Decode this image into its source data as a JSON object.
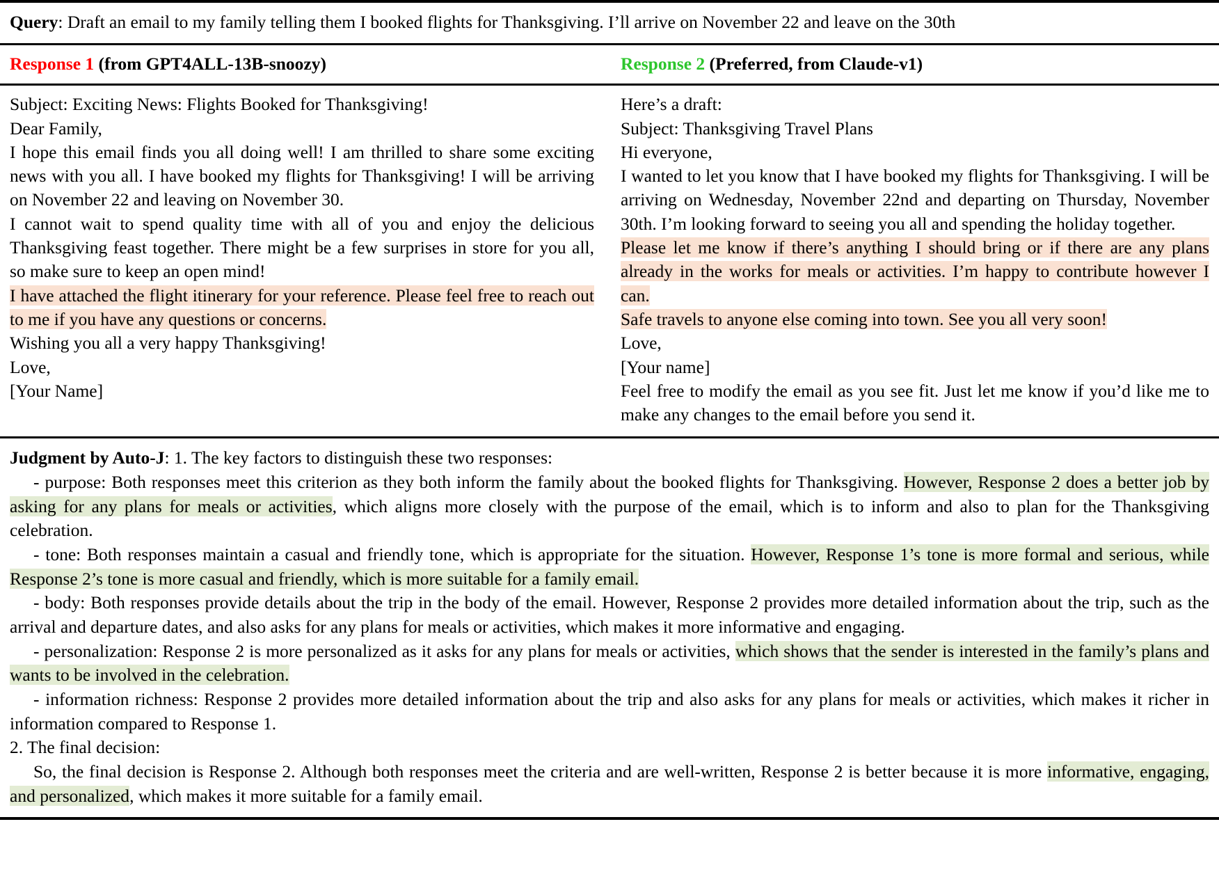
{
  "colors": {
    "response1_accent": "#ff0000",
    "response2_accent": "#2dc62d",
    "highlight_orange": "#fae1d2",
    "highlight_green": "#e3ecd4",
    "rule": "#000000",
    "background": "#ffffff"
  },
  "query": {
    "label": "Query",
    "separator": ": ",
    "text": "Draft an email to my family telling them I booked flights for Thanksgiving. I’ll arrive on November 22 and leave on the 30th"
  },
  "responses": [
    {
      "id": "response-1",
      "heading_number": "Response 1",
      "heading_meta": " (from GPT4ALL-13B-snoozy)",
      "accent": "#ff0000",
      "lines": [
        {
          "plain": "Subject: Exciting News: Flights Booked for Thanksgiving!"
        },
        {
          "plain": "Dear Family,"
        },
        {
          "plain": "I hope this email finds you all doing well!  I am thrilled to share some exciting news with you all.  I have booked my flights for Thanksgiving! I will be arriving on November 22 and leaving on November 30."
        },
        {
          "plain": "I cannot wait to spend quality time with all of you and enjoy the de­licious Thanksgiving feast together. There might be a few surprises in store for you all, so make sure to keep an open mind!"
        },
        {
          "highlight": "I have attached the flight itinerary for your reference. Please feel free to reach out to me if you have any questions or concerns."
        },
        {
          "plain": "Wishing you all a very happy Thanksgiving!"
        },
        {
          "plain": "Love,"
        },
        {
          "plain": "[Your Name]"
        }
      ]
    },
    {
      "id": "response-2",
      "heading_number": "Response 2",
      "heading_meta": " (Preferred, from Claude-v1)",
      "accent": "#2dc62d",
      "lines": [
        {
          "plain": "Here’s a draft:"
        },
        {
          "plain": "Subject: Thanksgiving Travel Plans"
        },
        {
          "plain": "Hi everyone,"
        },
        {
          "plain": "I wanted to let you know that I have booked my flights for Thanks­giving.  I will be arriving on Wednesday, November 22nd and departing on Thursday, November 30th.  I’m looking forward to seeing you all and spending the holiday together."
        },
        {
          "highlight": "Please let me know if there’s anything I should bring or if there are any plans already in the works for meals or activities. I’m happy to contribute however I can."
        },
        {
          "highlight": "Safe travels to anyone else coming into town. See you all very soon!"
        },
        {
          "plain": "Love,"
        },
        {
          "plain": "[Your name]"
        },
        {
          "plain": "Feel free to modify the email as you see fit.  Just let me know if you’d like me to make any changes to the email before you send it."
        }
      ]
    }
  ],
  "judgment": {
    "label": "Judgment by Auto-J",
    "separator": ": ",
    "intro": "1. The key factors to distinguish these two responses:",
    "criteria": [
      {
        "name": "purpose",
        "pre": "- purpose:  Both responses meet this criterion as they both inform the family about the booked flights for Thanksgiving. ",
        "hl": " However, Response 2 does a better job by asking for any plans for meals or activities",
        "post": ", which aligns more closely with the purpose of the email, which is to inform and also to plan for the Thanksgiving celebration."
      },
      {
        "name": "tone",
        "pre": "- tone: Both responses maintain a casual and friendly tone, which is appropriate for the situation. ",
        "hl": " However, Response 1’s tone is more formal and serious, while Response 2’s tone is more casual and friendly, which is more suitable for a family email. ",
        "post": ""
      },
      {
        "name": "body",
        "pre": "- body: Both responses provide details about the trip in the body of the email. However, Response 2 provides more detailed information about the trip, such as the arrival and departure dates, and also asks for any plans for meals or activities, which makes it more informative and engaging.",
        "hl": "",
        "post": ""
      },
      {
        "name": "personalization",
        "pre": "- personalization:  Response 2 is more personalized as it asks for any plans for meals or activities, ",
        "hl": " which shows that the sender is interested in the family’s plans and wants to be involved in the celebration. ",
        "post": ""
      },
      {
        "name": "information richness",
        "pre": "- information richness: Response 2 provides more detailed information about the trip and also asks for any plans for meals or activities, which makes it richer in information compared to Response 1.",
        "hl": "",
        "post": ""
      }
    ],
    "final_heading": "2. The final decision:",
    "final_pre": "So, the final decision is Response 2. Although both responses meet the criteria and are well-written, Response 2 is better because it is more ",
    "final_hl": " informative, engaging, and personalized",
    "final_post": ", which makes it more suitable for a family email."
  }
}
